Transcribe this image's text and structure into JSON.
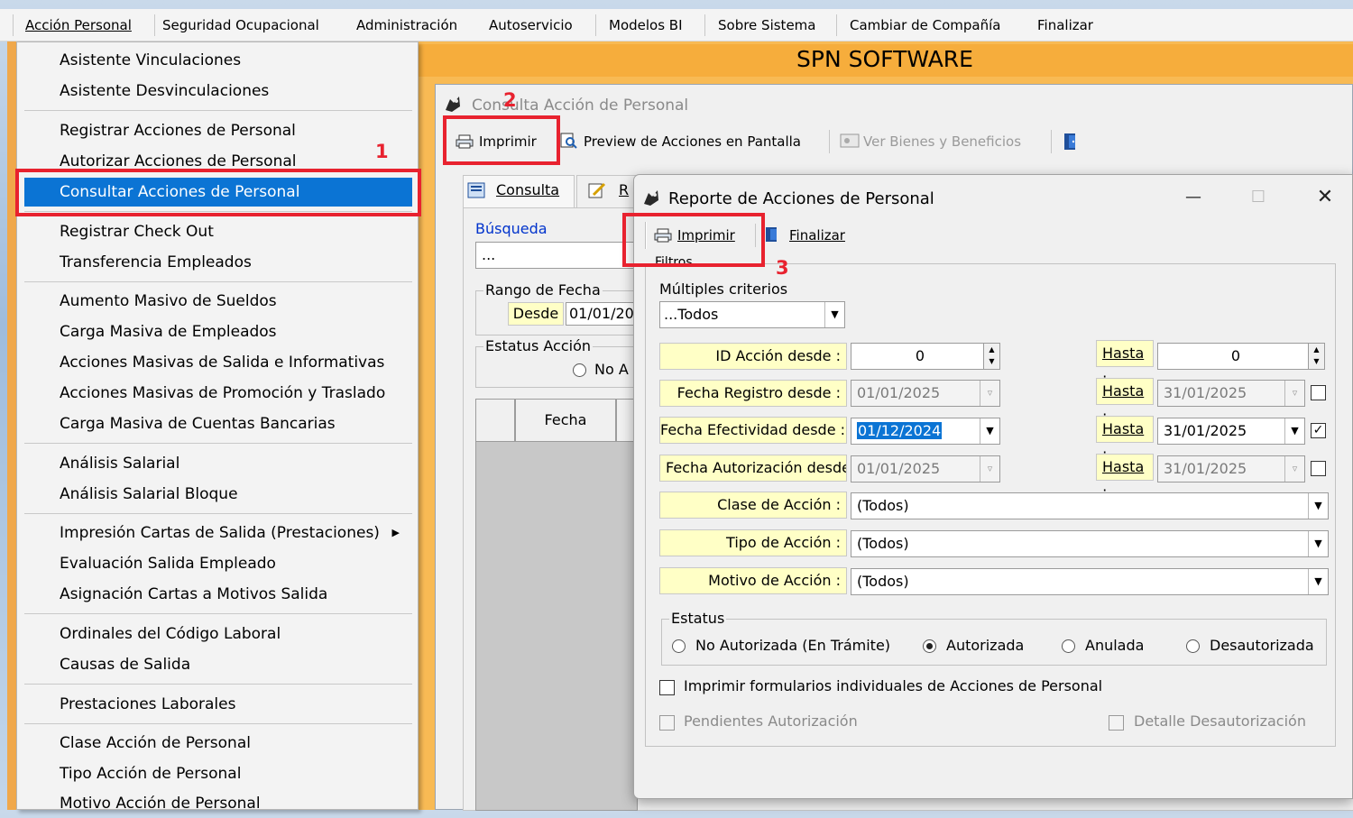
{
  "menubar": {
    "items": [
      "Acción Personal",
      "Seguridad Ocupacional",
      "Administración",
      "Autoservicio",
      "Modelos BI",
      "Sobre Sistema",
      "Cambiar de Compañía",
      "Finalizar"
    ]
  },
  "banner": {
    "company": "SPN SOFTWARE"
  },
  "dropdown": {
    "items": [
      "Asistente Vinculaciones",
      "Asistente Desvinculaciones",
      "Registrar Acciones de Personal",
      "Autorizar Acciones de Personal",
      "Consultar Acciones de Personal",
      "Registrar Check Out",
      "Transferencia Empleados",
      "Aumento Masivo de Sueldos",
      "Carga Masiva de Empleados",
      "Acciones Masivas de Salida e Informativas",
      "Acciones Masivas de Promoción y Traslado",
      "Carga Masiva de Cuentas Bancarias",
      "Análisis Salarial",
      "Análisis Salarial Bloque",
      "Impresión Cartas de Salida (Prestaciones)",
      "Evaluación Salida Empleado",
      "Asignación Cartas a Motivos Salida",
      "Ordinales del Código Laboral",
      "Causas de Salida",
      "Prestaciones Laborales",
      "Clase Acción de Personal",
      "Tipo Acción de Personal",
      "Motivo Acción de Personal"
    ]
  },
  "consulta": {
    "title": "Consulta Acción de Personal",
    "toolbar": {
      "imprimir": "Imprimir",
      "preview": "Preview de Acciones en Pantalla",
      "ver_bienes": "Ver Bienes y Beneficios"
    },
    "tab_consulta": "Consulta",
    "tab_second_partial": "R",
    "busqueda_label": "Búsqueda",
    "busqueda_value": "...",
    "rango_fecha": "Rango de Fecha",
    "desde_label": "Desde",
    "desde_value": "01/01/20",
    "estatus_accion": "Estatus Acción",
    "no_a_partial": "No A",
    "col_fecha": "Fecha"
  },
  "annotations": {
    "n1": "1",
    "n2": "2",
    "n3": "3"
  },
  "reporte": {
    "title": "Reporte de Acciones de Personal",
    "imprimir": "Imprimir",
    "finalizar": "Finalizar",
    "filtros": "Filtros",
    "multiples_criterios": "Múltiples criterios",
    "criterio_value": "...Todos",
    "rows": {
      "id_desde_label": "ID Acción desde :",
      "id_desde_value": "0",
      "id_hasta_value": "0",
      "registro_label": "Fecha Registro desde :",
      "registro_desde": "01/01/2025",
      "registro_hasta": "31/01/2025",
      "efectividad_label": "Fecha Efectividad desde :",
      "efectividad_desde": "01/12/2024",
      "efectividad_hasta": "31/01/2025",
      "autorizacion_label": "Fecha Autorización desde",
      "autorizacion_desde": "01/01/2025",
      "autorizacion_hasta": "31/01/2025",
      "hasta_label": "Hasta :",
      "clase_label": "Clase de Acción :",
      "clase_value": "(Todos)",
      "tipo_label": "Tipo de Acción :",
      "tipo_value": "(Todos)",
      "motivo_label": "Motivo de Acción :",
      "motivo_value": "(Todos)"
    },
    "estatus": {
      "label": "Estatus",
      "options": [
        "No Autorizada (En Trámite)",
        "Autorizada",
        "Anulada",
        "Desautorizada"
      ],
      "selected": "Autorizada"
    },
    "chk_imprimir_formularios": "Imprimir formularios individuales de Acciones de Personal",
    "chk_pendientes": "Pendientes Autorización",
    "chk_detalle": "Detalle Desautorización",
    "window_controls": {
      "minimize": "—",
      "maximize": "☐",
      "close": "✕"
    }
  },
  "colors": {
    "highlight": "#0b74d4",
    "annotation_red": "#e8222f",
    "yellow_label": "#ffffc6",
    "app_orange": "#f8ba54"
  }
}
